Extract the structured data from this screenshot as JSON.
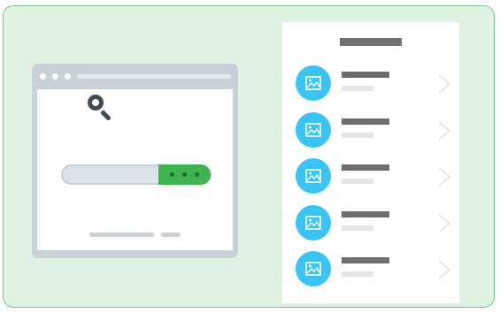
{
  "illustration": {
    "background_color": "#dff2e3",
    "border_color": "#7ac48b",
    "browser": {
      "frame_color": "#c9d0d8",
      "icons": [
        "magnifier-icon"
      ],
      "search_button_color": "#3db44f"
    },
    "results": {
      "item_count": 5,
      "thumbnail_color": "#3bc4f3",
      "icons": [
        "image-icon",
        "chevron-right-icon"
      ]
    }
  }
}
